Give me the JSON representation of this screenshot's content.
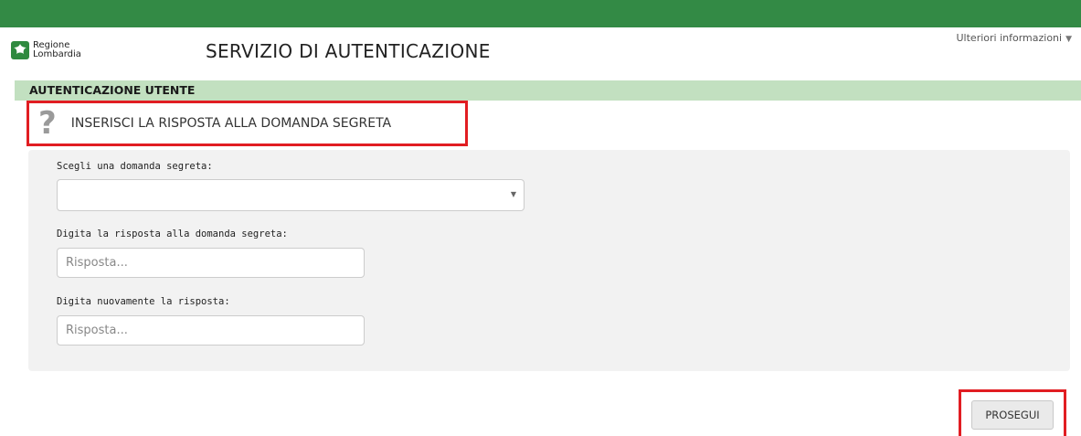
{
  "header": {
    "logo_line1": "Regione",
    "logo_line2": "Lombardia",
    "title": "SERVIZIO DI AUTENTICAZIONE",
    "more_info": "Ulteriori informazioni",
    "colors": {
      "top_bar": "#338a45",
      "section_bar": "#c2e0c0",
      "highlight": "#e11d22"
    }
  },
  "section": {
    "title": "AUTENTICAZIONE UTENTE"
  },
  "heading": {
    "icon": "question-mark-icon",
    "text": "INSERISCI LA RISPOSTA ALLA DOMANDA SEGRETA"
  },
  "form": {
    "question_label": "Scegli una domanda segreta:",
    "question_value": "",
    "answer_label": "Digita la risposta alla domanda segreta:",
    "answer_placeholder": "Risposta...",
    "answer_value": "",
    "confirm_label": "Digita nuovamente la risposta:",
    "confirm_placeholder": "Risposta...",
    "confirm_value": ""
  },
  "actions": {
    "proceed_label": "PROSEGUI"
  }
}
